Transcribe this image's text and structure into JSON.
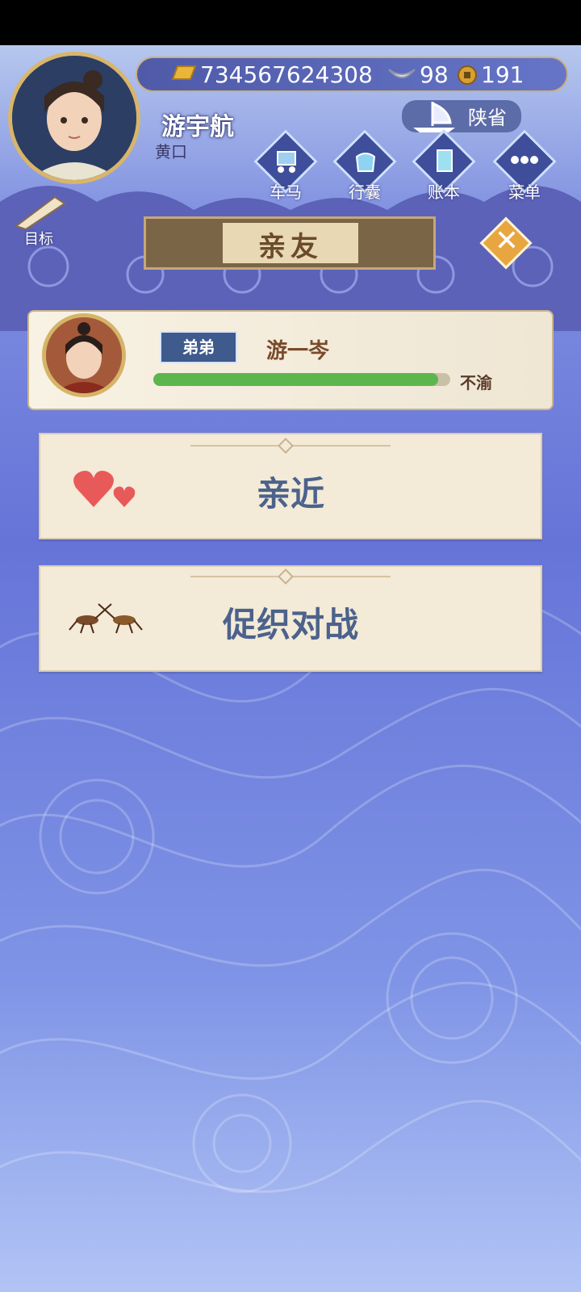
{
  "header": {
    "player_name": "游宇航",
    "player_rank": "黄口",
    "resources": {
      "gold": "734567624308",
      "silver": "98",
      "coin": "191"
    },
    "region": "陕省",
    "nav": [
      {
        "label": "车马",
        "icon": "carriage-icon"
      },
      {
        "label": "行囊",
        "icon": "bag-icon"
      },
      {
        "label": "账本",
        "icon": "ledger-icon"
      },
      {
        "label": "菜单",
        "icon": "menu-icon"
      }
    ],
    "goal_label": "目标"
  },
  "panel": {
    "title": "亲友",
    "member": {
      "relation": "弟弟",
      "name": "游一岑",
      "mood": "不渝",
      "mood_level": 0.96
    },
    "actions": [
      {
        "label": "亲近",
        "icon": "hearts-icon"
      },
      {
        "label": "促织对战",
        "icon": "cricket-icon"
      }
    ]
  },
  "colors": {
    "accent": "#e8a640",
    "bar": "#5cb64e",
    "action_text": "#4c628c"
  }
}
